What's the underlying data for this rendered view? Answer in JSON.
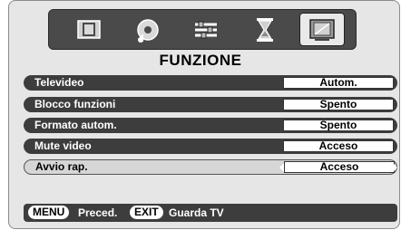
{
  "tabs": [
    {
      "icon": "picture-icon",
      "active": false
    },
    {
      "icon": "sound-icon",
      "active": false
    },
    {
      "icon": "settings-sliders-icon",
      "active": false
    },
    {
      "icon": "timer-hourglass-icon",
      "active": false
    },
    {
      "icon": "function-screen-icon",
      "active": true
    }
  ],
  "title": "FUNZIONE",
  "rows": [
    {
      "label": "Televideo",
      "value": "Autom."
    },
    {
      "label": "Blocco funzioni",
      "value": "Spento"
    },
    {
      "label": "Formato autom.",
      "value": "Spento"
    },
    {
      "label": "Mute video",
      "value": "Acceso"
    },
    {
      "label": "Avvio rap.",
      "value": "Acceso"
    }
  ],
  "footer": {
    "menu_key": "MENU",
    "menu_text": "Preced.",
    "exit_key": "EXIT",
    "exit_text": "Guarda TV"
  },
  "colors": {
    "row_bg": "#3d3d3d",
    "selected_row_bg": "#d6d6d6",
    "iconbar_bg": "#4a4a4a",
    "panel_bg": "#e6e6e6"
  }
}
